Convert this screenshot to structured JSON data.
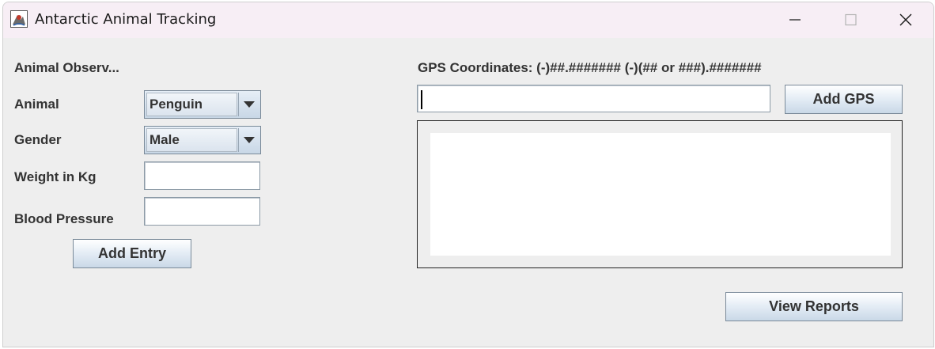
{
  "window": {
    "title": "Antarctic Animal Tracking",
    "icon": "java-app-icon",
    "controls": [
      "minimize-icon",
      "maximize-icon",
      "close-icon"
    ]
  },
  "form": {
    "heading": "Animal Observ...",
    "animal": {
      "label": "Animal",
      "selected": "Penguin"
    },
    "gender": {
      "label": "Gender",
      "selected": "Male"
    },
    "weight": {
      "label": "Weight in Kg",
      "value": ""
    },
    "blood_pressure": {
      "label": "Blood Pressure",
      "value": ""
    },
    "add_entry_label": "Add Entry"
  },
  "gps": {
    "label": "GPS Coordinates: (-)##.####### (-)(## or ###).#######",
    "value": "",
    "add_gps_label": "Add GPS",
    "entries": []
  },
  "view_reports_label": "View Reports"
}
